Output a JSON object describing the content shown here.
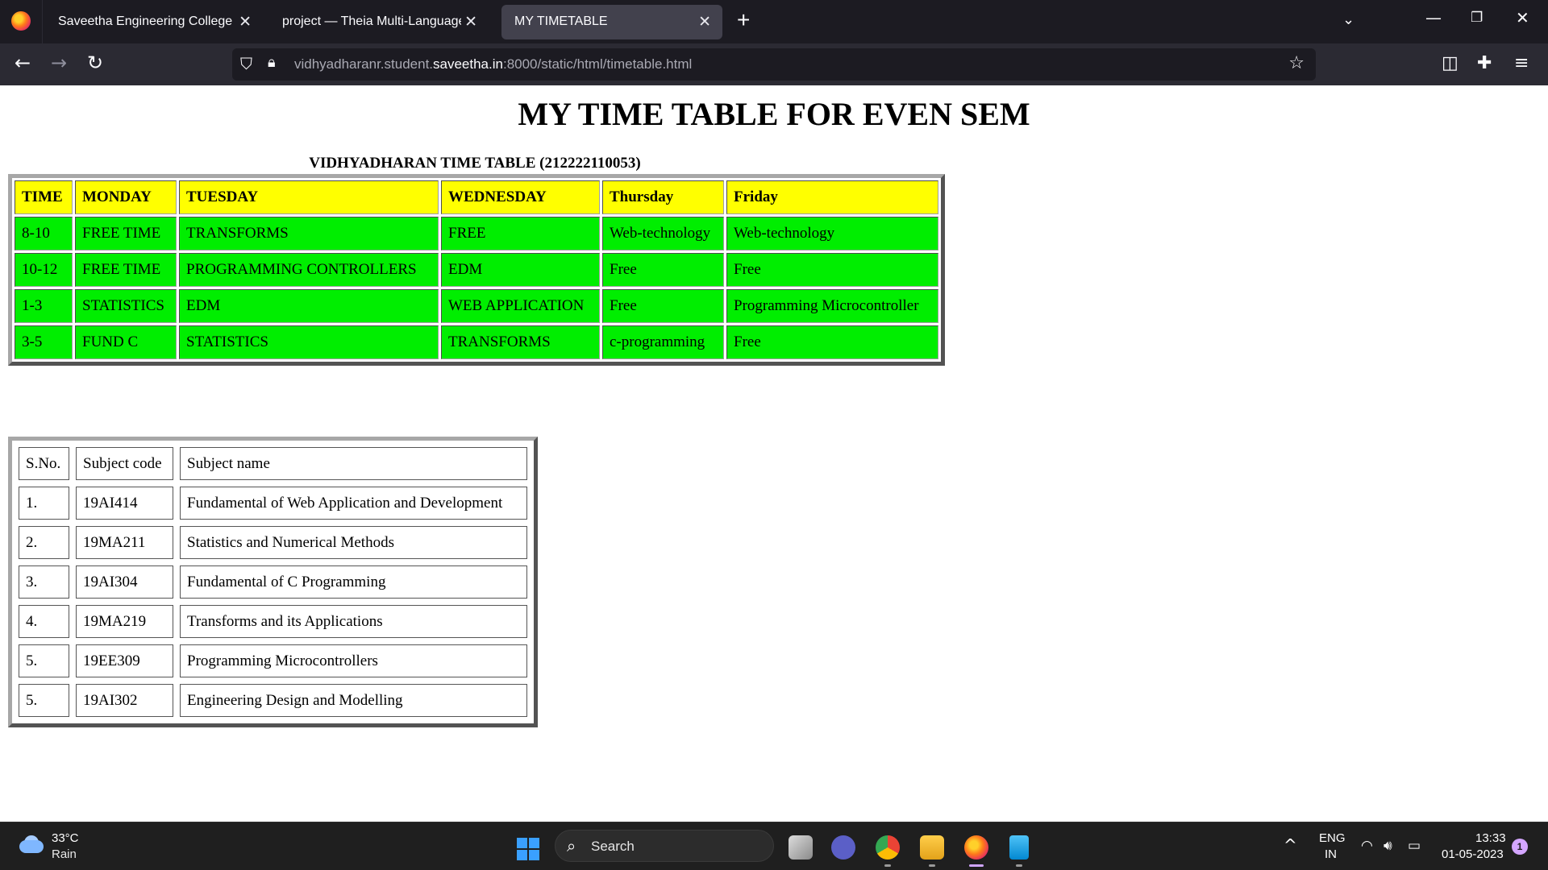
{
  "browser": {
    "tabs": [
      {
        "title": "Saveetha Engineering College",
        "active": false
      },
      {
        "title": "project — Theia Multi-Language Ex",
        "active": false
      },
      {
        "title": "MY TIMETABLE",
        "active": true
      }
    ],
    "close_glyph": "✕",
    "new_tab_glyph": "+",
    "url": {
      "prefix": "vidhyadharanr.student.",
      "host": "saveetha.in",
      "suffix": ":8000/static/html/timetable.html"
    }
  },
  "page": {
    "title": "MY TIME TABLE FOR EVEN SEM",
    "timetable": {
      "caption": "VIDHYADHARAN TIME TABLE (212222110053)",
      "headers": [
        "TIME",
        "MONDAY",
        "TUESDAY",
        "WEDNESDAY",
        "Thursday",
        "Friday"
      ],
      "rows": [
        [
          "8-10",
          "FREE TIME",
          "TRANSFORMS",
          "FREE",
          "Web-technology",
          "Web-technology"
        ],
        [
          "10-12",
          "FREE TIME",
          "PROGRAMMING CONTROLLERS",
          "EDM",
          "Free",
          "Free"
        ],
        [
          "1-3",
          "STATISTICS",
          "EDM",
          "WEB APPLICATION",
          "Free",
          "Programming Microcontroller"
        ],
        [
          "3-5",
          "FUND C",
          "STATISTICS",
          "TRANSFORMS",
          "c-programming",
          "Free"
        ]
      ],
      "header_color": "#ffff00",
      "cell_color": "#00ee00"
    },
    "subjects": {
      "headers": [
        "S.No.",
        "Subject code",
        "Subject name"
      ],
      "rows": [
        [
          "1.",
          "19AI414",
          "Fundamental of Web Application and Development"
        ],
        [
          "2.",
          "19MA211",
          "Statistics and Numerical Methods"
        ],
        [
          "3.",
          "19AI304",
          "Fundamental of C Programming"
        ],
        [
          "4.",
          "19MA219",
          "Transforms and its Applications"
        ],
        [
          "5.",
          "19EE309",
          "Programming Microcontrollers"
        ],
        [
          "5.",
          "19AI302",
          "Engineering Design and Modelling"
        ]
      ]
    }
  },
  "taskbar": {
    "weather_temp": "33°C",
    "weather_desc": "Rain",
    "search_label": "Search",
    "lang_line1": "ENG",
    "lang_line2": "IN",
    "time": "13:33",
    "date": "01-05-2023",
    "notification_count": "1"
  },
  "icons": {
    "back": "back-arrow-icon",
    "forward": "forward-arrow-icon",
    "reload": "reload-icon",
    "shield": "tracking-shield-icon",
    "lock": "lock-icon",
    "star": "bookmark-star-icon",
    "pocket": "pocket-icon",
    "extensions": "extensions-icon",
    "menu": "hamburger-menu-icon"
  }
}
